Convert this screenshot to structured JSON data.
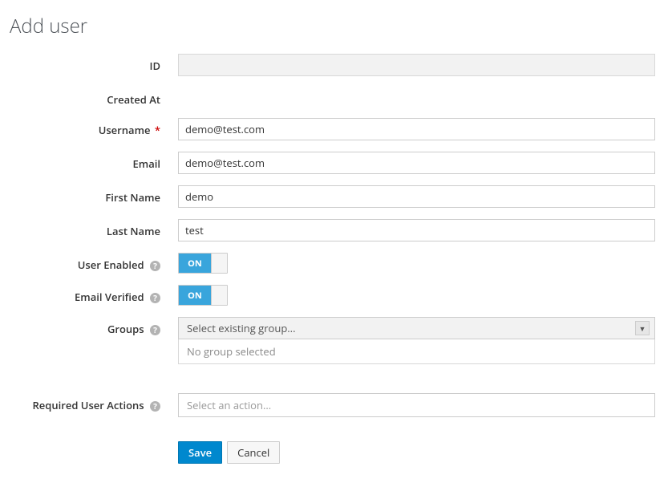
{
  "title": "Add user",
  "labels": {
    "id": "ID",
    "created_at": "Created At",
    "username": "Username",
    "email": "Email",
    "first_name": "First Name",
    "last_name": "Last Name",
    "user_enabled": "User Enabled",
    "email_verified": "Email Verified",
    "groups": "Groups",
    "required_actions": "Required User Actions"
  },
  "values": {
    "id": "",
    "created_at": "",
    "username": "demo@test.com",
    "email": "demo@test.com",
    "first_name": "demo",
    "last_name": "test"
  },
  "toggles": {
    "user_enabled": "ON",
    "email_verified": "ON"
  },
  "groups": {
    "placeholder": "Select existing group...",
    "empty_text": "No group selected"
  },
  "required_actions": {
    "placeholder": "Select an action..."
  },
  "buttons": {
    "save": "Save",
    "cancel": "Cancel"
  }
}
